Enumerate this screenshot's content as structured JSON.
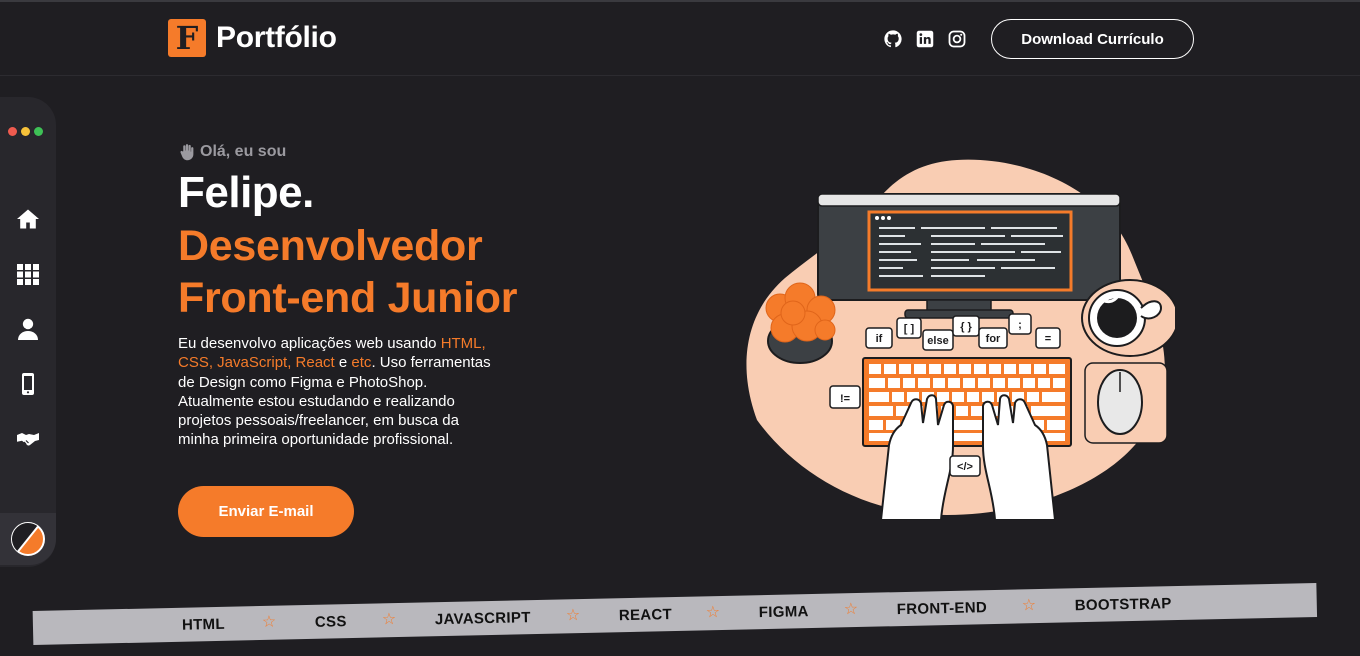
{
  "header": {
    "logo_letter": "F",
    "logo_text": "Portfólio",
    "socials": [
      "github-icon",
      "linkedin-icon",
      "instagram-icon"
    ],
    "download_label": "Download Currículo"
  },
  "sidebar": {
    "items": [
      "home-icon",
      "grid-icon",
      "user-icon",
      "phone-icon",
      "handshake-icon"
    ]
  },
  "hero": {
    "greeting": "Olá, eu sou",
    "name": "Felipe.",
    "role_line1": "Desenvolvedor",
    "role_line2": "Front-end Junior",
    "desc_part1": "Eu desenvolvo aplicações web usando ",
    "desc_techs": "HTML, CSS, JavaScript, React",
    "desc_part2": " e ",
    "desc_etc": "etc",
    "desc_part3": ". Uso ferramentas de Design como Figma e PhotoShop. Atualmente estou estudando e realizando projetos pessoais/freelancer, em busca da minha primeira oportunidade profissional.",
    "email_label": "Enviar E-mail"
  },
  "illustration": {
    "bubbles": [
      "if",
      "[ ]",
      "else",
      "{ }",
      "for",
      ";",
      "=",
      "!=",
      "</>"
    ]
  },
  "ticker": {
    "items": [
      "HTML",
      "CSS",
      "JAVASCRIPT",
      "REACT",
      "FIGMA",
      "FRONT-END",
      "BOOTSTRAP"
    ]
  },
  "colors": {
    "background": "#1f1e22",
    "accent": "#f57b2a",
    "sidebar": "#28272c",
    "ticker": "#b9b8bd"
  }
}
